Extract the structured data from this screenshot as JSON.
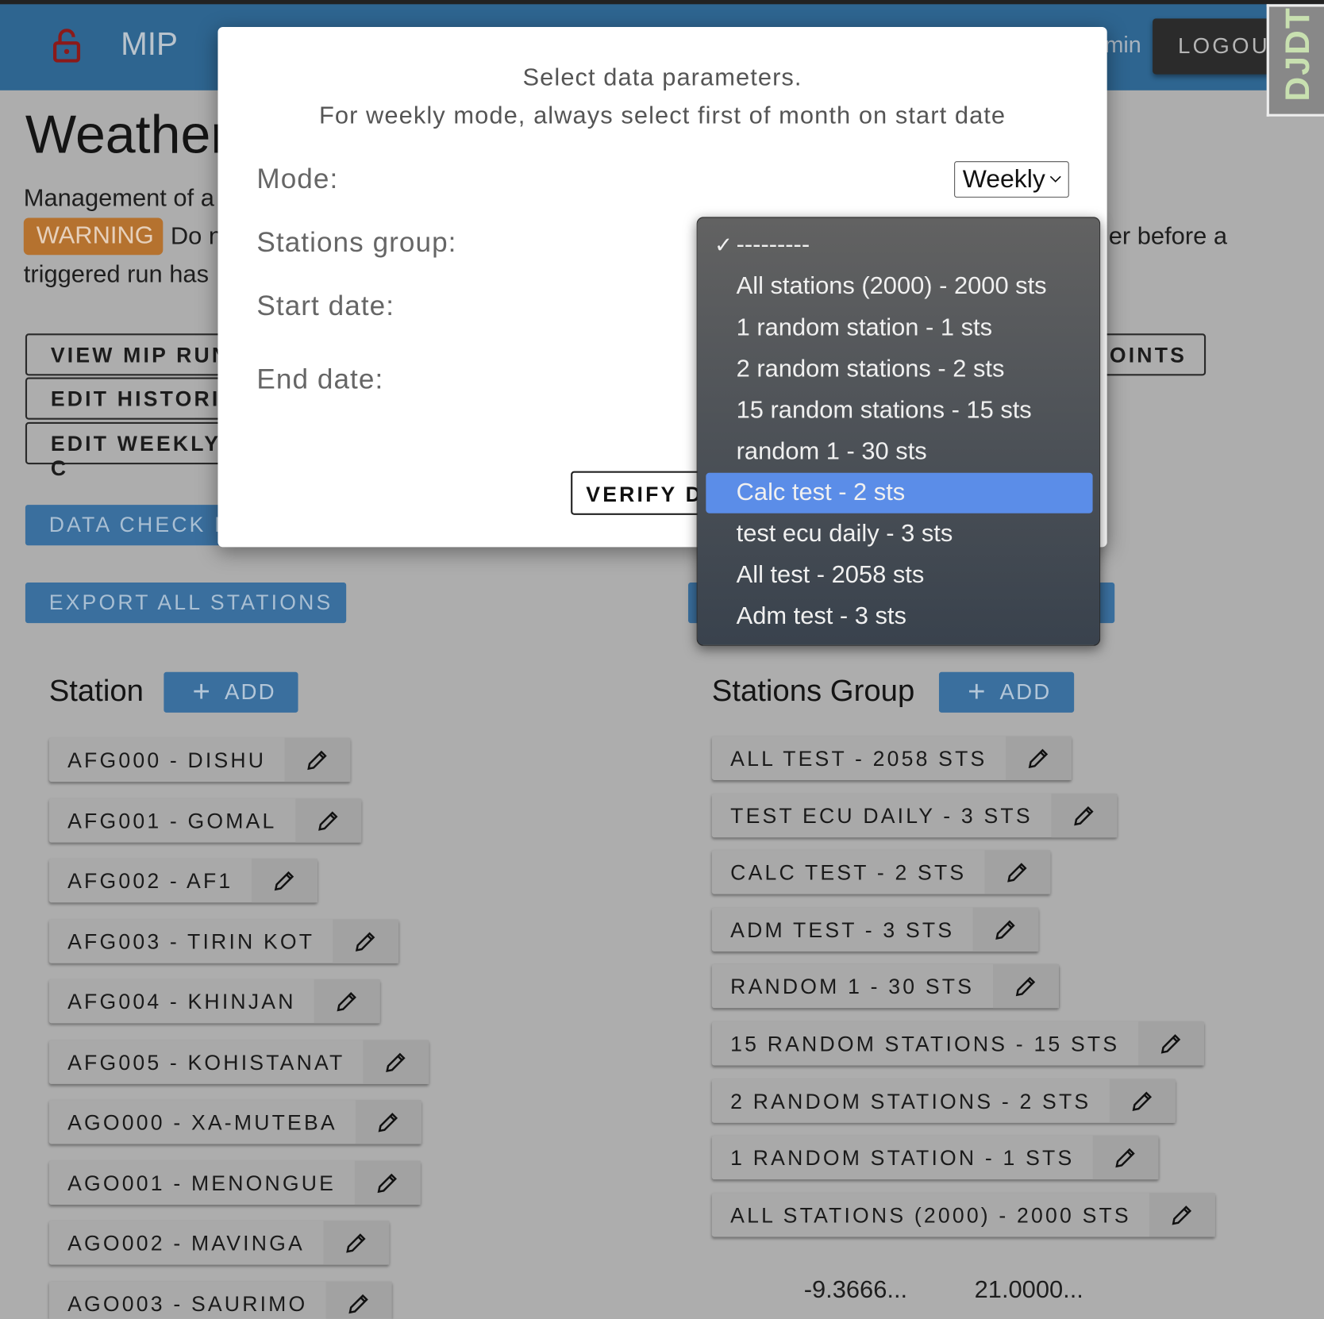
{
  "header": {
    "brand": "MIP",
    "user_partial": "min",
    "logout_label": "LOGOUT",
    "debug_toolbar": "DJDT",
    "lock_color": "#8b1a1a",
    "bg": "#2e6590"
  },
  "page": {
    "title": "Weather",
    "description_partial": "Management of a",
    "warning_badge": "WARNING",
    "warning_text_partial": "Do n",
    "warning_text_right": "er before a",
    "warning_line2_partial": "triggered run has"
  },
  "buttons": {
    "view_mip_runs": "VIEW MIP RUN",
    "edit_historic": "EDIT HISTORIC",
    "edit_weekly": "EDIT WEEKLY C",
    "right_points": "OINTS",
    "data_check": "DATA CHECK F",
    "export_all": "EXPORT ALL STATIONS"
  },
  "station": {
    "heading": "Station",
    "add_label": "ADD",
    "items": [
      "AFG000 - DISHU",
      "AFG001 - GOMAL",
      "AFG002 - AF1",
      "AFG003 - TIRIN KOT",
      "AFG004 - KHINJAN",
      "AFG005 - KOHISTANAT",
      "AGO000 - XA-MUTEBA",
      "AGO001 - MENONGUE",
      "AGO002 - MAVINGA",
      "AGO003 - SAURIMO"
    ]
  },
  "groups": {
    "heading": "Stations Group",
    "add_label": "ADD",
    "items": [
      "ALL TEST - 2058 STS",
      "TEST ECU DAILY - 3 STS",
      "CALC TEST - 2 STS",
      "ADM TEST - 3 STS",
      "RANDOM 1 - 30 STS",
      "15 RANDOM STATIONS - 15 STS",
      "2 RANDOM STATIONS - 2 STS",
      "1 RANDOM STATION - 1 STS",
      "ALL STATIONS (2000) - 2000 STS"
    ]
  },
  "coords": {
    "lat": "-9.3666...",
    "lon": "21.0000..."
  },
  "modal": {
    "line1": "Select data parameters.",
    "line2": "For weekly mode, always select first of month on start date",
    "mode_label": "Mode:",
    "mode_value": "Weekly",
    "group_label": "Stations group:",
    "start_label": "Start date:",
    "end_label": "End date:",
    "verify_label": "VERIFY DATA"
  },
  "dropdown": {
    "selected_index": 0,
    "highlighted_index": 6,
    "highlight_color": "#5b8de8",
    "options": [
      "---------",
      "All stations (2000) - 2000 sts",
      "1 random station - 1 sts",
      "2 random stations - 2 sts",
      "15 random stations - 15 sts",
      "random 1 - 30 sts",
      "Calc test - 2 sts",
      "test ecu daily - 3 sts",
      "All test - 2058 sts",
      "Adm test - 3 sts"
    ]
  }
}
